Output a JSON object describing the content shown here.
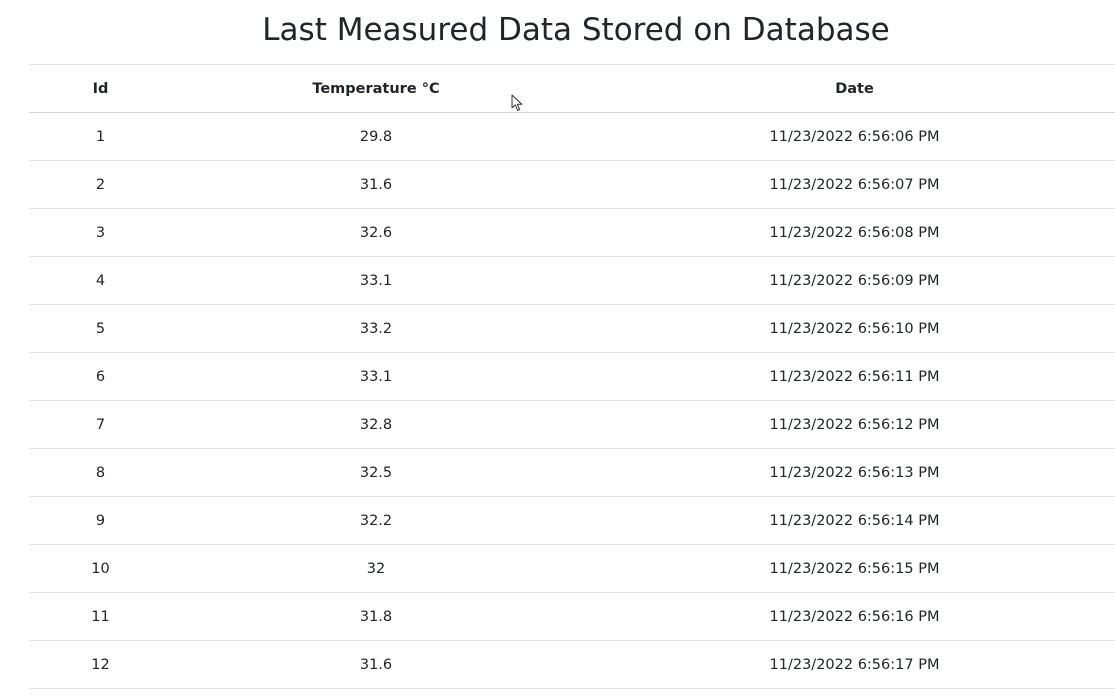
{
  "page": {
    "title": "Last Measured Data Stored on Database"
  },
  "table": {
    "headers": {
      "id": "Id",
      "temperature": "Temperature °C",
      "date": "Date"
    },
    "rows": [
      {
        "id": "1",
        "temperature": "29.8",
        "date": "11/23/2022 6:56:06 PM"
      },
      {
        "id": "2",
        "temperature": "31.6",
        "date": "11/23/2022 6:56:07 PM"
      },
      {
        "id": "3",
        "temperature": "32.6",
        "date": "11/23/2022 6:56:08 PM"
      },
      {
        "id": "4",
        "temperature": "33.1",
        "date": "11/23/2022 6:56:09 PM"
      },
      {
        "id": "5",
        "temperature": "33.2",
        "date": "11/23/2022 6:56:10 PM"
      },
      {
        "id": "6",
        "temperature": "33.1",
        "date": "11/23/2022 6:56:11 PM"
      },
      {
        "id": "7",
        "temperature": "32.8",
        "date": "11/23/2022 6:56:12 PM"
      },
      {
        "id": "8",
        "temperature": "32.5",
        "date": "11/23/2022 6:56:13 PM"
      },
      {
        "id": "9",
        "temperature": "32.2",
        "date": "11/23/2022 6:56:14 PM"
      },
      {
        "id": "10",
        "temperature": "32",
        "date": "11/23/2022 6:56:15 PM"
      },
      {
        "id": "11",
        "temperature": "31.8",
        "date": "11/23/2022 6:56:16 PM"
      },
      {
        "id": "12",
        "temperature": "31.6",
        "date": "11/23/2022 6:56:17 PM"
      }
    ]
  },
  "icons": {
    "cursor": "mouse-pointer-icon"
  }
}
